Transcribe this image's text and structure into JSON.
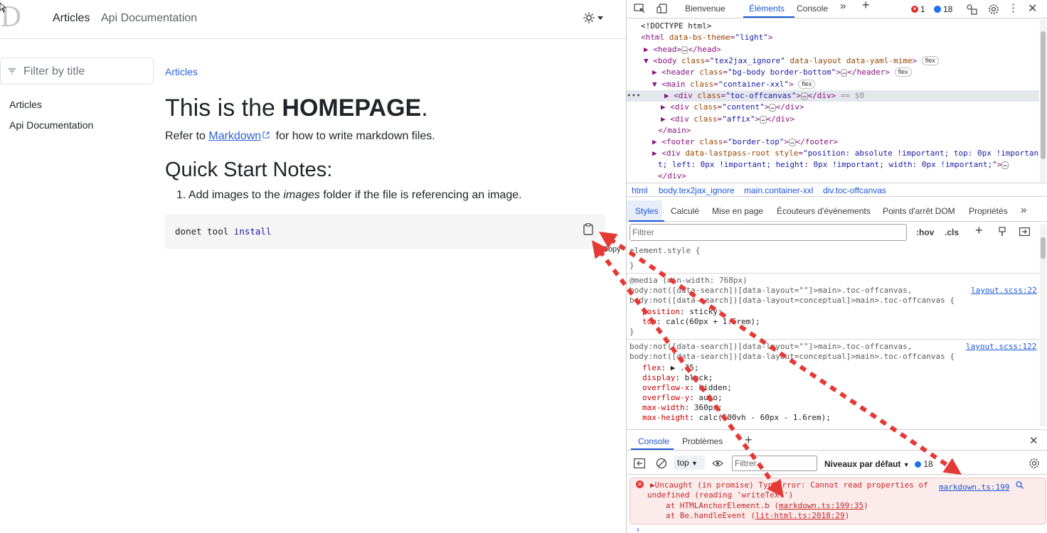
{
  "site": {
    "logo_text": "D",
    "nav": {
      "articles": "Articles",
      "api": "Api Documentation"
    },
    "filter_placeholder": "Filter by title",
    "toc": [
      "Articles",
      "Api Documentation"
    ],
    "breadcrumb": "Articles",
    "title_prefix": "This is the ",
    "title_bold": "HOMEPAGE",
    "title_suffix": ".",
    "intro_before": "Refer to ",
    "intro_link": "Markdown",
    "intro_after": " for how to write markdown files.",
    "subhead": "Quick Start Notes:",
    "step_num": "1.",
    "step_before": " Add images to the ",
    "step_em": "images",
    "step_after": " folder if the file is referencing an image.",
    "code_plain": "donet tool ",
    "code_keyword": "install",
    "copy_tooltip": "Copy"
  },
  "devtools": {
    "tabs": [
      "Bienvenue",
      "Éléments",
      "Console"
    ],
    "error_count": "1",
    "message_count": "18",
    "dom": {
      "l1": "<!DOCTYPE html>",
      "html_tag": "<html",
      "html_attr": " data-bs-theme",
      "html_val": "\"light\"",
      "head": "<head>",
      "head_close": "</head>",
      "body_tag": "<body",
      "body_attr1": " class",
      "body_val1": "\"tex2jax_ignore\"",
      "body_attr2": " data-layout data-yaml-mime",
      "header_tag": "<header",
      "header_attr": " class",
      "header_val": "\"bg-body border-bottom\"",
      "header_close": "</header>",
      "main_tag": "<main",
      "main_attr": " class",
      "main_val": "\"container-xxl\"",
      "toc_div": "<div",
      "toc_attr": " class",
      "toc_val": "\"toc-offcanvas\"",
      "div_close": "</div>",
      "sel_marker": "== $0",
      "content_val": "\"content\"",
      "affix_val": "\"affix\"",
      "main_close": "</main>",
      "footer_tag": "<footer",
      "footer_val": "\"border-top\"",
      "footer_close": "</footer>",
      "lp_tag": "<div",
      "lp_attr": " data-lastpass-root style",
      "lp_val1": "\"position: absolute !important; top: 0px !importan",
      "lp_val2": "t; left: 0px !important; height: 0px !important; width: 0px !important;\"",
      "lp_close": "</div>",
      "flex_pill": "flex",
      "ellipsis": "…",
      "gt": ">"
    },
    "crumbs": [
      "html",
      "body.tex2jax_ignore",
      "main.container-xxl",
      "div.toc-offcanvas"
    ],
    "sub_tabs": [
      "Styles",
      "Calculé",
      "Mise en page",
      "Écouteurs d'événements",
      "Points d'arrêt DOM",
      "Propriétés"
    ],
    "styles_filter_placeholder": "Filtrer",
    "hov": ":hov",
    "cls": ".cls",
    "styles": {
      "element_style": "element.style {",
      "close_brace": "}",
      "media": "@media (min-width: 768px)",
      "rule1_sel1": "body:not([data-search])[data-layout=\"\"]>main>.toc-offcanvas,",
      "rule1_sel2": "body:not([data-search])[data-layout=conceptual]>main>.toc-offcanvas {",
      "rule1_src": "layout.scss:22",
      "rule1_p1_name": "position",
      "rule1_p1_val": "sticky;",
      "rule1_p2_name": "top",
      "rule1_p2_val": "calc(60px + 1.6rem);",
      "rule2_sel1": "body:not([data-search])[data-layout=\"\"]>main>.toc-offcanvas,",
      "rule2_sel2": "body:not([data-search])[data-layout=conceptual]>main>.toc-offcanvas {",
      "rule2_src": "layout.scss:122",
      "r2p1n": "flex",
      "r2p1v": "▶ .35;",
      "r2p2n": "display",
      "r2p2v": "block;",
      "r2p3n": "overflow-x",
      "r2p3v": "hidden;",
      "r2p4n": "overflow-y",
      "r2p4v": "auto;",
      "r2p5n": "max-width",
      "r2p5v": "360px;",
      "r2p6n": "max-height",
      "r2p6v": "calc(100vh - 60px - 1.6rem);"
    },
    "drawer_tabs": [
      "Console",
      "Problèmes"
    ],
    "context": "top",
    "console_filter_placeholder": "Filtrer",
    "levels": "Niveaux par défaut",
    "console_msg_count": "18",
    "error": {
      "line1": "▶Uncaught (in promise) TypeError: Cannot read properties of",
      "line2": "undefined (reading 'writeText')",
      "line3_before": "at HTMLAnchorElement.b (",
      "line3_link": "markdown.ts:199:35",
      "line3_after": ")",
      "line4_before": "at Be.handleEvent (",
      "line4_link": "lit-html.ts:2018:29",
      "line4_after": ")",
      "source_link": "markdown.ts:199"
    },
    "prompt": "›"
  },
  "annotation": {
    "arrow_color": "#e53935"
  }
}
